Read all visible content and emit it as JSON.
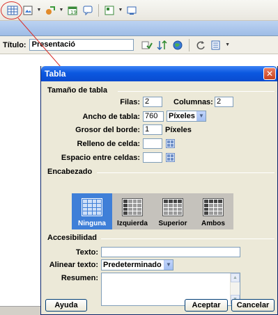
{
  "app": {
    "title_label": "Título:",
    "title_value": "Presentació"
  },
  "dialog": {
    "title": "Tabla",
    "size_section": "Tamaño de tabla",
    "rows_label": "Filas:",
    "rows_value": "2",
    "cols_label": "Columnas:",
    "cols_value": "2",
    "width_label": "Ancho de tabla:",
    "width_value": "760",
    "width_unit": "Píxeles",
    "border_label": "Grosor del borde:",
    "border_value": "1",
    "border_unit": "Píxeles",
    "padding_label": "Relleno de celda:",
    "padding_value": "",
    "spacing_label": "Espacio entre celdas:",
    "spacing_value": "",
    "header_section": "Encabezado",
    "header_options": [
      "Ninguna",
      "Izquierda",
      "Superior",
      "Ambos"
    ],
    "header_selected": "Ninguna",
    "access_section": "Accesibilidad",
    "caption_label": "Texto:",
    "caption_value": "",
    "align_label": "Alinear texto:",
    "align_value": "Predeterminado",
    "summary_label": "Resumen:",
    "summary_value": "",
    "help_button": "Ayuda",
    "ok_button": "Aceptar",
    "cancel_button": "Cancelar"
  },
  "colors": {
    "titlebar": "#0b58e0",
    "selected_header": "#3f7fd8",
    "annotation": "#d8302a"
  }
}
